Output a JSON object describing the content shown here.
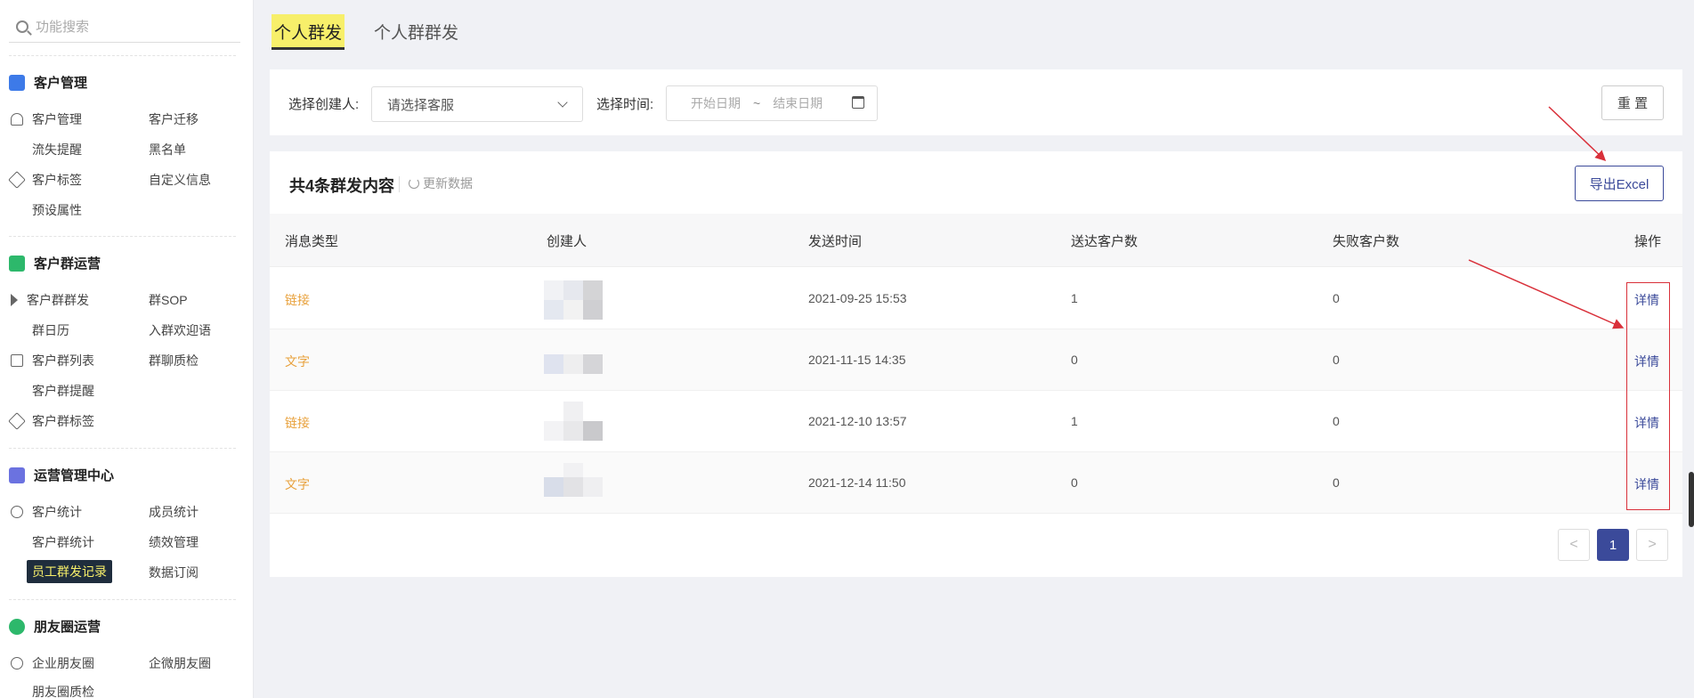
{
  "sidebar": {
    "search_placeholder": "功能搜索",
    "groups": [
      {
        "title": "客户管理",
        "color": "#3d7ae8",
        "items": [
          "客户管理",
          "客户迁移",
          "流失提醒",
          "黑名单",
          "客户标签",
          "自定义信息",
          "预设属性"
        ]
      },
      {
        "title": "客户群运营",
        "color": "#2db86b",
        "items": [
          "客户群群发",
          "群SOP",
          "群日历",
          "入群欢迎语",
          "客户群列表",
          "群聊质检",
          "客户群提醒",
          "客户群标签"
        ]
      },
      {
        "title": "运营管理中心",
        "color": "#6b72e0",
        "items": [
          "客户统计",
          "成员统计",
          "客户群统计",
          "绩效管理",
          "员工群发记录",
          "数据订阅"
        ]
      },
      {
        "title": "朋友圈运营",
        "color": "#2db86b",
        "items": [
          "企业朋友圈",
          "企微朋友圈",
          "朋友圈质检"
        ]
      }
    ],
    "active_item": "员工群发记录"
  },
  "tabs": [
    {
      "label": "个人群发",
      "active": true
    },
    {
      "label": "个人群群发",
      "active": false
    }
  ],
  "filter": {
    "creator_label": "选择创建人:",
    "creator_placeholder": "请选择客服",
    "time_label": "选择时间:",
    "start_placeholder": "开始日期",
    "range_sep": "~",
    "end_placeholder": "结束日期",
    "reset_label": "重 置"
  },
  "list": {
    "title": "共4条群发内容",
    "refresh_label": "更新数据",
    "export_label": "导出Excel",
    "columns": [
      "消息类型",
      "创建人",
      "发送时间",
      "送达客户数",
      "失败客户数",
      "操作"
    ],
    "rows": [
      {
        "type": "链接",
        "time": "2021-09-25 15:53",
        "delivered": "1",
        "failed": "0",
        "action": "详情"
      },
      {
        "type": "文字",
        "time": "2021-11-15 14:35",
        "delivered": "0",
        "failed": "0",
        "action": "详情"
      },
      {
        "type": "链接",
        "time": "2021-12-10 13:57",
        "delivered": "1",
        "failed": "0",
        "action": "详情"
      },
      {
        "type": "文字",
        "time": "2021-12-14 11:50",
        "delivered": "0",
        "failed": "0",
        "action": "详情"
      }
    ]
  },
  "pagination": {
    "prev": "<",
    "current": "1",
    "next": ">"
  },
  "colors": {
    "accent": "#3b4a9a",
    "type_text": "#e8a13c",
    "annotation": "#d9303a",
    "tab_highlight": "#f7ef6a"
  }
}
